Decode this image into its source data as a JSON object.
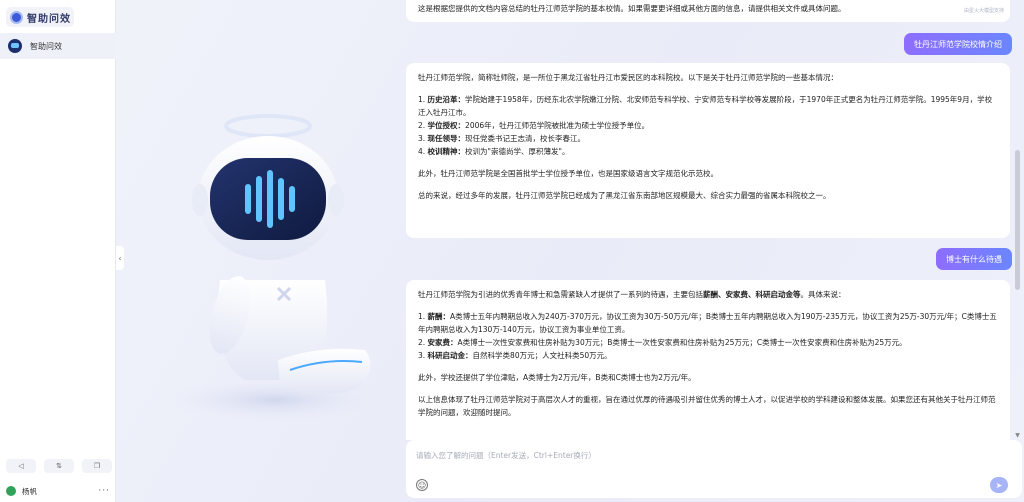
{
  "app": {
    "logo_text": "智助问效"
  },
  "sidebar": {
    "items": [
      {
        "label": "智助问效",
        "icon": "robot-avatar-icon"
      }
    ],
    "tools": [
      {
        "glyph": "◁",
        "icon": "collapse-icon"
      },
      {
        "glyph": "⇅",
        "icon": "swap-icon"
      },
      {
        "glyph": "❐",
        "icon": "copy-icon"
      }
    ],
    "user": {
      "name": "杨帆",
      "more": "···"
    },
    "collapse_glyph": "‹"
  },
  "chat": {
    "badge": "由星火大模型支持",
    "messages": [
      {
        "role": "ai",
        "paragraphs": [
          "这是根据您提供的文档内容总结的牡丹江师范学院的基本校情。如果需要更详细或其他方面的信息，请提供相关文件或具体问题。"
        ]
      },
      {
        "role": "user",
        "text": "牡丹江师范学院校情介绍"
      },
      {
        "role": "ai",
        "intro": "牡丹江师范学院，简称牡师院，是一所位于黑龙江省牡丹江市爱民区的本科院校。以下是关于牡丹江师范学院的一些基本情况：",
        "list": [
          {
            "num": "1.",
            "title": "历史沿革：",
            "text": "学院始建于1958年，历经东北农学院嫩江分院、北安师范专科学校、宁安师范专科学校等发展阶段，于1970年正式更名为牡丹江师范学院。1995年9月，学校迁入牡丹江市。"
          },
          {
            "num": "2.",
            "title": "学位授权：",
            "text": "2006年，牡丹江师范学院被批准为硕士学位授予单位。"
          },
          {
            "num": "3.",
            "title": "现任领导：",
            "text": "现任党委书记王志清，校长李春江。"
          },
          {
            "num": "4.",
            "title": "校训精神：",
            "text": "校训为\"崇德尚学、厚积薄发\"。"
          }
        ],
        "extra": "此外，牡丹江师范学院是全国首批学士学位授予单位，也是国家级语言文字规范化示范校。",
        "summary": "总的来说，经过多年的发展，牡丹江师范学院已经成为了黑龙江省东南部地区规模最大、综合实力最强的省属本科院校之一。"
      },
      {
        "role": "user",
        "text": "博士有什么待遇"
      },
      {
        "role": "ai",
        "intro_pre": "牡丹江师范学院为引进的优秀青年博士和急需紧缺人才提供了一系列的待遇，主要包括",
        "intro_bold": "薪酬、安家费、科研启动金等",
        "intro_post": "。具体来说：",
        "list": [
          {
            "num": "1.",
            "title": "薪酬：",
            "text": "A类博士五年内聘期总收入为240万-370万元，协议工资为30万-50万元/年；B类博士五年内聘期总收入为190万-235万元，协议工资为25万-30万元/年；C类博士五年内聘期总收入为130万-140万元，协议工资为事业单位工资。"
          },
          {
            "num": "2.",
            "title": "安家费：",
            "text": "A类博士一次性安家费和住房补贴为30万元；B类博士一次性安家费和住房补贴为25万元；C类博士一次性安家费和住房补贴为25万元。"
          },
          {
            "num": "3.",
            "title": "科研启动金：",
            "text": "自然科学类80万元；人文社科类50万元。"
          }
        ],
        "extra": "此外，学校还提供了学位津贴，A类博士为2万元/年，B类和C类博士也为2万元/年。",
        "summary": "以上信息体现了牡丹江师范学院对于高层次人才的重视，旨在通过优厚的待遇吸引并留住优秀的博士人才，以促进学校的学科建设和整体发展。如果您还有其他关于牡丹江师范学院的问题，欢迎随时提问。"
      }
    ]
  },
  "input": {
    "placeholder": "请输入您了解的问题（Enter发送，Ctrl+Enter换行）",
    "value": "",
    "emoji_glyph": "☺",
    "send_glyph": "➤"
  },
  "colors": {
    "accent_start": "#8e6dff",
    "accent_end": "#6b86ff",
    "robot_visor": "#1a2a5c",
    "robot_glow": "#5fc4ff"
  }
}
